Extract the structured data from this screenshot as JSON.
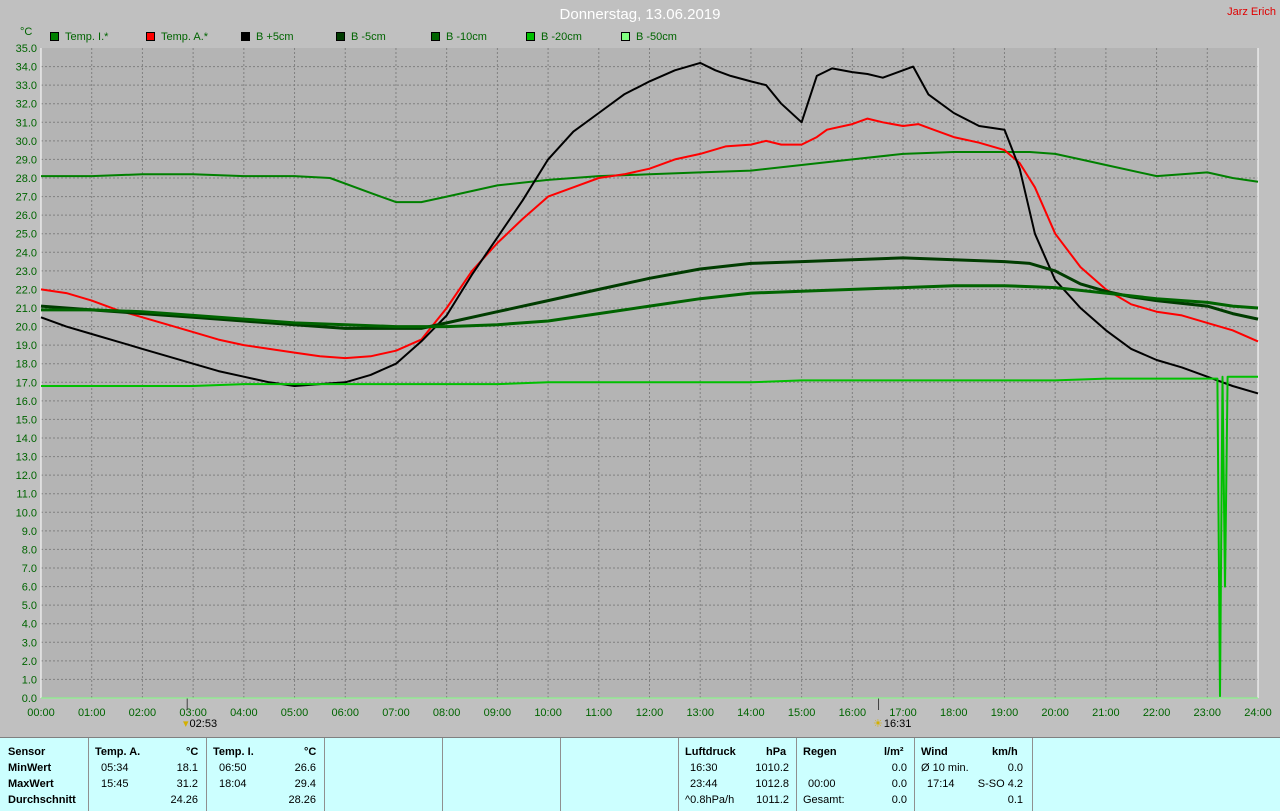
{
  "header": {
    "title": "Donnerstag, 13.06.2019",
    "author": "Jarz Erich",
    "y_unit": "°C"
  },
  "legend": [
    {
      "label": "Temp. I.*",
      "color": "#008000"
    },
    {
      "label": "Temp. A.*",
      "color": "#ff0000"
    },
    {
      "label": "B +5cm",
      "color": "#000000"
    },
    {
      "label": "B -5cm",
      "color": "#003c00"
    },
    {
      "label": "B -10cm",
      "color": "#006400"
    },
    {
      "label": "B -20cm",
      "color": "#00c000"
    },
    {
      "label": "B -50cm",
      "color": "#80ff80"
    }
  ],
  "events": [
    {
      "label": "02:53",
      "icon": "moon-icon"
    },
    {
      "label": "16:31",
      "icon": "sun-icon"
    }
  ],
  "chart_data": {
    "type": "line",
    "title": "Donnerstag, 13.06.2019",
    "ylabel": "°C",
    "xlabel": "",
    "xlim": [
      0,
      24
    ],
    "ylim": [
      0,
      35
    ],
    "x_ticks": [
      "00:00",
      "01:00",
      "02:00",
      "03:00",
      "04:00",
      "05:00",
      "06:00",
      "07:00",
      "08:00",
      "09:00",
      "10:00",
      "11:00",
      "12:00",
      "13:00",
      "14:00",
      "15:00",
      "16:00",
      "17:00",
      "18:00",
      "19:00",
      "20:00",
      "21:00",
      "22:00",
      "23:00",
      "24:00"
    ],
    "y_ticks": [
      "0.0",
      "1.0",
      "2.0",
      "3.0",
      "4.0",
      "5.0",
      "6.0",
      "7.0",
      "8.0",
      "9.0",
      "10.0",
      "11.0",
      "12.0",
      "13.0",
      "14.0",
      "15.0",
      "16.0",
      "17.0",
      "18.0",
      "19.0",
      "20.0",
      "21.0",
      "22.0",
      "23.0",
      "24.0",
      "25.0",
      "26.0",
      "27.0",
      "28.0",
      "29.0",
      "30.0",
      "31.0",
      "32.0",
      "33.0",
      "34.0",
      "35.0"
    ],
    "grid": true,
    "series": [
      {
        "name": "Temp. I.*",
        "color": "#008000",
        "width": 2,
        "x": [
          0,
          1,
          2,
          3,
          4,
          5,
          5.7,
          6.5,
          7,
          7.5,
          8,
          9,
          10,
          11,
          12,
          13,
          14,
          15,
          16,
          17,
          18,
          19,
          19.5,
          20,
          20.5,
          21,
          22,
          23,
          23.5,
          24
        ],
        "y": [
          28.1,
          28.1,
          28.2,
          28.2,
          28.1,
          28.1,
          28.0,
          27.2,
          26.7,
          26.7,
          27.0,
          27.6,
          27.9,
          28.1,
          28.2,
          28.3,
          28.4,
          28.7,
          29.0,
          29.3,
          29.4,
          29.4,
          29.4,
          29.3,
          29.0,
          28.7,
          28.1,
          28.3,
          28.0,
          27.8
        ]
      },
      {
        "name": "Temp. A.*",
        "color": "#ff0000",
        "width": 2,
        "x": [
          0,
          0.5,
          1,
          1.5,
          2,
          2.5,
          3,
          3.5,
          4,
          4.5,
          5,
          5.5,
          6,
          6.5,
          7,
          7.5,
          8,
          8.5,
          9,
          9.5,
          10,
          10.5,
          11,
          11.5,
          12,
          12.5,
          13,
          13.5,
          14,
          14.3,
          14.6,
          15,
          15.3,
          15.5,
          16,
          16.3,
          16.6,
          17,
          17.3,
          17.6,
          18,
          18.5,
          19,
          19.3,
          19.6,
          20,
          20.5,
          21,
          21.5,
          22,
          22.5,
          23,
          23.5,
          24
        ],
        "y": [
          22.0,
          21.8,
          21.4,
          20.9,
          20.5,
          20.1,
          19.7,
          19.3,
          19.0,
          18.8,
          18.6,
          18.4,
          18.3,
          18.4,
          18.7,
          19.3,
          21.0,
          23.0,
          24.5,
          25.8,
          27.0,
          27.5,
          28.0,
          28.2,
          28.5,
          29.0,
          29.3,
          29.7,
          29.8,
          30.0,
          29.8,
          29.8,
          30.2,
          30.6,
          30.9,
          31.2,
          31.0,
          30.8,
          30.9,
          30.6,
          30.2,
          29.9,
          29.5,
          28.8,
          27.5,
          25.0,
          23.2,
          22.0,
          21.2,
          20.8,
          20.6,
          20.2,
          19.8,
          19.2
        ]
      },
      {
        "name": "B +5cm",
        "color": "#000000",
        "width": 2,
        "x": [
          0,
          0.5,
          1,
          1.5,
          2,
          2.5,
          3,
          3.5,
          4,
          4.5,
          5,
          5.5,
          6,
          6.5,
          7,
          7.5,
          8,
          8.5,
          9,
          9.5,
          10,
          10.5,
          11,
          11.5,
          12,
          12.5,
          13,
          13.3,
          13.6,
          14,
          14.3,
          14.6,
          15,
          15.3,
          15.6,
          16,
          16.3,
          16.6,
          17,
          17.2,
          17.5,
          18,
          18.5,
          19,
          19.3,
          19.6,
          20,
          20.5,
          21,
          21.5,
          22,
          22.5,
          23,
          23.5,
          24
        ],
        "y": [
          20.5,
          20.0,
          19.6,
          19.2,
          18.8,
          18.4,
          18.0,
          17.6,
          17.3,
          17.0,
          16.8,
          16.9,
          17.0,
          17.4,
          18.0,
          19.2,
          20.6,
          22.8,
          24.8,
          26.8,
          29.0,
          30.5,
          31.5,
          32.5,
          33.2,
          33.8,
          34.2,
          33.8,
          33.5,
          33.2,
          33.0,
          32.0,
          31.0,
          33.5,
          33.9,
          33.7,
          33.6,
          33.4,
          33.8,
          34.0,
          32.5,
          31.5,
          30.8,
          30.6,
          28.5,
          25.0,
          22.5,
          21.0,
          19.8,
          18.8,
          18.2,
          17.8,
          17.3,
          16.8,
          16.4
        ]
      },
      {
        "name": "B -5cm",
        "color": "#003c00",
        "width": 3,
        "x": [
          0,
          1,
          2,
          3,
          4,
          5,
          6,
          7,
          7.5,
          8,
          9,
          10,
          11,
          12,
          13,
          14,
          15,
          16,
          17,
          18,
          19,
          19.5,
          20,
          20.5,
          21,
          21.5,
          22,
          23,
          23.5,
          24
        ],
        "y": [
          21.1,
          20.9,
          20.7,
          20.5,
          20.3,
          20.1,
          19.9,
          19.9,
          19.9,
          20.2,
          20.8,
          21.4,
          22.0,
          22.6,
          23.1,
          23.4,
          23.5,
          23.6,
          23.7,
          23.6,
          23.5,
          23.4,
          23.0,
          22.3,
          21.9,
          21.6,
          21.4,
          21.1,
          20.7,
          20.4
        ]
      },
      {
        "name": "B -10cm",
        "color": "#006400",
        "width": 3,
        "x": [
          0,
          1,
          2,
          3,
          4,
          5,
          6,
          7,
          8,
          9,
          10,
          11,
          12,
          13,
          14,
          15,
          16,
          17,
          18,
          19,
          20,
          21,
          22,
          23,
          23.5,
          24
        ],
        "y": [
          20.9,
          20.9,
          20.8,
          20.6,
          20.4,
          20.2,
          20.1,
          20.0,
          20.0,
          20.1,
          20.3,
          20.7,
          21.1,
          21.5,
          21.8,
          21.9,
          22.0,
          22.1,
          22.2,
          22.2,
          22.1,
          21.8,
          21.5,
          21.3,
          21.1,
          21.0
        ]
      },
      {
        "name": "B -20cm",
        "color": "#00c000",
        "width": 2,
        "x": [
          0,
          1,
          2,
          3,
          4,
          5,
          6,
          7,
          8,
          9,
          10,
          11,
          12,
          13,
          14,
          15,
          16,
          17,
          18,
          19,
          20,
          21,
          22,
          23,
          23.2,
          23.25,
          23.3,
          23.35,
          23.4,
          23.5,
          24
        ],
        "y": [
          16.8,
          16.8,
          16.8,
          16.8,
          16.9,
          16.9,
          16.9,
          16.9,
          16.9,
          16.9,
          17.0,
          17.0,
          17.0,
          17.0,
          17.0,
          17.1,
          17.1,
          17.1,
          17.1,
          17.1,
          17.1,
          17.2,
          17.2,
          17.2,
          17.2,
          0.1,
          17.3,
          6.0,
          17.3,
          17.3,
          17.3
        ]
      },
      {
        "name": "B -50cm",
        "color": "#80ff80",
        "width": 1,
        "x": [
          0,
          24
        ],
        "y": [
          0,
          0
        ]
      }
    ]
  },
  "stats": {
    "col_sensor": {
      "header": "Sensor",
      "rows": [
        "MinWert",
        "MaxWert",
        "Durchschnitt"
      ]
    },
    "temp_a": {
      "header": "Temp. A.",
      "unit": "°C",
      "min_time": "05:34",
      "min_val": "18.1",
      "max_time": "15:45",
      "max_val": "31.2",
      "avg_val": "24.26"
    },
    "temp_i": {
      "header": "Temp. I.",
      "unit": "°C",
      "min_time": "06:50",
      "min_val": "26.6",
      "max_time": "18:04",
      "max_val": "29.4",
      "avg_val": "28.26"
    },
    "luftdruck": {
      "header": "Luftdruck",
      "unit": "hPa",
      "r1_time": "16:30",
      "r1_val": "1010.2",
      "r2_time": "23:44",
      "r2_val": "1012.8",
      "r3_label": "^0.8hPa/h",
      "r3_val": "1011.2"
    },
    "regen": {
      "header": "Regen",
      "unit": "l/m²",
      "r2_time": "00:00",
      "r2_val": "0.0",
      "r1_val": "0.0",
      "r3_label": "Gesamt:",
      "r3_val": "0.0"
    },
    "wind": {
      "header": "Wind",
      "unit": "km/h",
      "r1_label": "Ø 10 min.",
      "r1_val": "0.0",
      "r2_time": "17:14",
      "r2_val": "S-SO 4.2",
      "r3_val": "0.1"
    }
  }
}
